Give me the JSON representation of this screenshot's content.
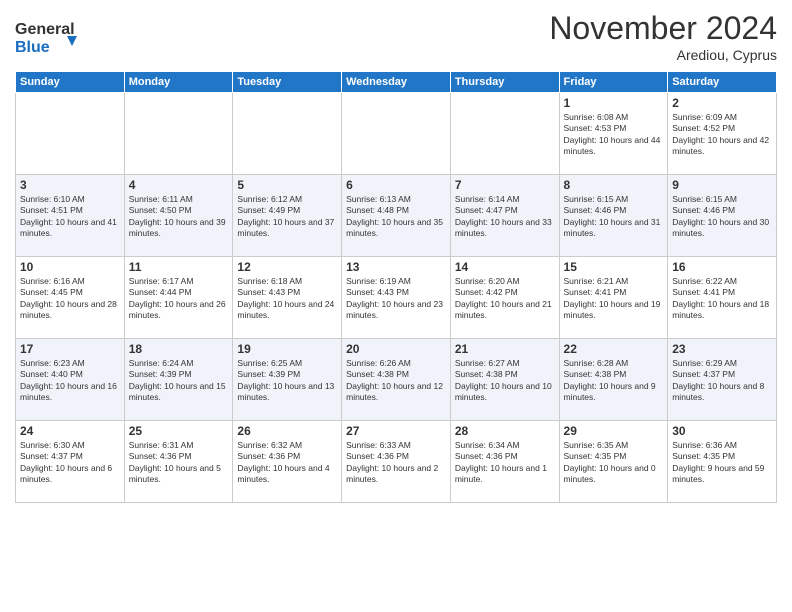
{
  "logo": {
    "line1": "General",
    "line2": "Blue"
  },
  "title": "November 2024",
  "location": "Arediou, Cyprus",
  "days_header": [
    "Sunday",
    "Monday",
    "Tuesday",
    "Wednesday",
    "Thursday",
    "Friday",
    "Saturday"
  ],
  "weeks": [
    [
      {
        "day": "",
        "content": ""
      },
      {
        "day": "",
        "content": ""
      },
      {
        "day": "",
        "content": ""
      },
      {
        "day": "",
        "content": ""
      },
      {
        "day": "",
        "content": ""
      },
      {
        "day": "1",
        "content": "Sunrise: 6:08 AM\nSunset: 4:53 PM\nDaylight: 10 hours and 44 minutes."
      },
      {
        "day": "2",
        "content": "Sunrise: 6:09 AM\nSunset: 4:52 PM\nDaylight: 10 hours and 42 minutes."
      }
    ],
    [
      {
        "day": "3",
        "content": "Sunrise: 6:10 AM\nSunset: 4:51 PM\nDaylight: 10 hours and 41 minutes."
      },
      {
        "day": "4",
        "content": "Sunrise: 6:11 AM\nSunset: 4:50 PM\nDaylight: 10 hours and 39 minutes."
      },
      {
        "day": "5",
        "content": "Sunrise: 6:12 AM\nSunset: 4:49 PM\nDaylight: 10 hours and 37 minutes."
      },
      {
        "day": "6",
        "content": "Sunrise: 6:13 AM\nSunset: 4:48 PM\nDaylight: 10 hours and 35 minutes."
      },
      {
        "day": "7",
        "content": "Sunrise: 6:14 AM\nSunset: 4:47 PM\nDaylight: 10 hours and 33 minutes."
      },
      {
        "day": "8",
        "content": "Sunrise: 6:15 AM\nSunset: 4:46 PM\nDaylight: 10 hours and 31 minutes."
      },
      {
        "day": "9",
        "content": "Sunrise: 6:15 AM\nSunset: 4:46 PM\nDaylight: 10 hours and 30 minutes."
      }
    ],
    [
      {
        "day": "10",
        "content": "Sunrise: 6:16 AM\nSunset: 4:45 PM\nDaylight: 10 hours and 28 minutes."
      },
      {
        "day": "11",
        "content": "Sunrise: 6:17 AM\nSunset: 4:44 PM\nDaylight: 10 hours and 26 minutes."
      },
      {
        "day": "12",
        "content": "Sunrise: 6:18 AM\nSunset: 4:43 PM\nDaylight: 10 hours and 24 minutes."
      },
      {
        "day": "13",
        "content": "Sunrise: 6:19 AM\nSunset: 4:43 PM\nDaylight: 10 hours and 23 minutes."
      },
      {
        "day": "14",
        "content": "Sunrise: 6:20 AM\nSunset: 4:42 PM\nDaylight: 10 hours and 21 minutes."
      },
      {
        "day": "15",
        "content": "Sunrise: 6:21 AM\nSunset: 4:41 PM\nDaylight: 10 hours and 19 minutes."
      },
      {
        "day": "16",
        "content": "Sunrise: 6:22 AM\nSunset: 4:41 PM\nDaylight: 10 hours and 18 minutes."
      }
    ],
    [
      {
        "day": "17",
        "content": "Sunrise: 6:23 AM\nSunset: 4:40 PM\nDaylight: 10 hours and 16 minutes."
      },
      {
        "day": "18",
        "content": "Sunrise: 6:24 AM\nSunset: 4:39 PM\nDaylight: 10 hours and 15 minutes."
      },
      {
        "day": "19",
        "content": "Sunrise: 6:25 AM\nSunset: 4:39 PM\nDaylight: 10 hours and 13 minutes."
      },
      {
        "day": "20",
        "content": "Sunrise: 6:26 AM\nSunset: 4:38 PM\nDaylight: 10 hours and 12 minutes."
      },
      {
        "day": "21",
        "content": "Sunrise: 6:27 AM\nSunset: 4:38 PM\nDaylight: 10 hours and 10 minutes."
      },
      {
        "day": "22",
        "content": "Sunrise: 6:28 AM\nSunset: 4:38 PM\nDaylight: 10 hours and 9 minutes."
      },
      {
        "day": "23",
        "content": "Sunrise: 6:29 AM\nSunset: 4:37 PM\nDaylight: 10 hours and 8 minutes."
      }
    ],
    [
      {
        "day": "24",
        "content": "Sunrise: 6:30 AM\nSunset: 4:37 PM\nDaylight: 10 hours and 6 minutes."
      },
      {
        "day": "25",
        "content": "Sunrise: 6:31 AM\nSunset: 4:36 PM\nDaylight: 10 hours and 5 minutes."
      },
      {
        "day": "26",
        "content": "Sunrise: 6:32 AM\nSunset: 4:36 PM\nDaylight: 10 hours and 4 minutes."
      },
      {
        "day": "27",
        "content": "Sunrise: 6:33 AM\nSunset: 4:36 PM\nDaylight: 10 hours and 2 minutes."
      },
      {
        "day": "28",
        "content": "Sunrise: 6:34 AM\nSunset: 4:36 PM\nDaylight: 10 hours and 1 minute."
      },
      {
        "day": "29",
        "content": "Sunrise: 6:35 AM\nSunset: 4:35 PM\nDaylight: 10 hours and 0 minutes."
      },
      {
        "day": "30",
        "content": "Sunrise: 6:36 AM\nSunset: 4:35 PM\nDaylight: 9 hours and 59 minutes."
      }
    ]
  ]
}
